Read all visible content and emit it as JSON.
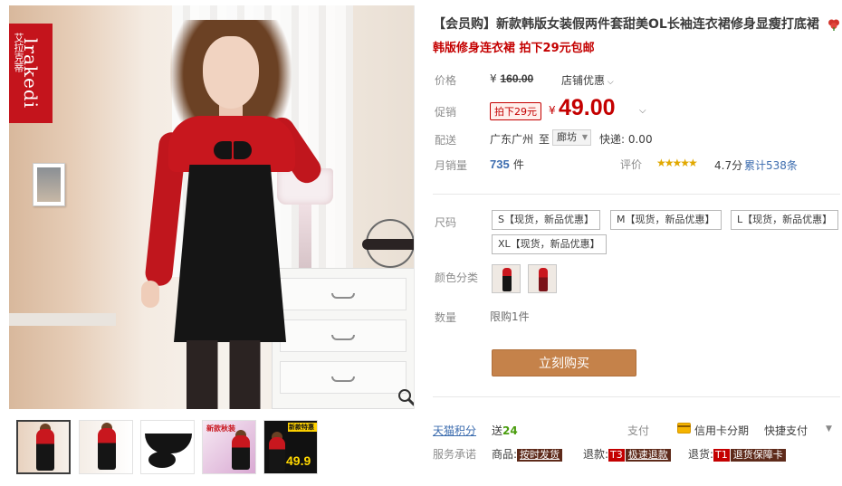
{
  "gallery": {
    "brand_logo_latin": "lrakedi",
    "brand_logo_cn": "艾拉克蒂",
    "thumbnails": [
      {
        "label": "",
        "active": true
      },
      {
        "label": "",
        "active": false
      },
      {
        "label": "",
        "active": false
      },
      {
        "label": "新款秋装",
        "active": false
      },
      {
        "label": "新款特惠",
        "price": "49.9",
        "active": false
      }
    ]
  },
  "product": {
    "title": "【会员购】新款韩版女装假两件套甜美OL长袖连衣裙修身显瘦打底裙",
    "subtitle": "韩版修身连衣裙 拍下29元包邮"
  },
  "price": {
    "label": "价格",
    "currency": "¥",
    "original": "160.00",
    "shop_promo": "店铺优惠"
  },
  "promo": {
    "label": "促销",
    "badge": "拍下29元",
    "currency": "¥",
    "price": "49.00"
  },
  "shipping": {
    "label": "配送",
    "from": "广东广州",
    "to_label": "至",
    "to": "廊坊",
    "express": "快递: 0.00"
  },
  "sales": {
    "label": "月销量",
    "count": "735",
    "unit": "件",
    "review_label": "评价",
    "stars": "★★★★★",
    "rating": "4.7分",
    "review_count": "累计538条"
  },
  "options": {
    "size_label": "尺码",
    "sizes": [
      "S【现货，新品优惠】",
      "M【现货，新品优惠】",
      "L【现货，新品优惠】",
      "XL【现货，新品优惠】"
    ],
    "color_label": "颜色分类",
    "quantity_label": "数量",
    "quantity_limit": "限购1件"
  },
  "actions": {
    "buy_now": "立刻购买"
  },
  "footer": {
    "points_label": "天猫积分",
    "points_prefix": "送",
    "points_value": "24",
    "pay_label": "支付",
    "pay_credit": "信用卡分期",
    "pay_express": "快捷支付",
    "service_label": "服务承诺",
    "goods_label": "商品:",
    "goods_tag": "按时发货",
    "refund_label": "退款:",
    "refund_code": "T3",
    "refund_tag": "极速退款",
    "return_label": "退货:",
    "return_code": "T1",
    "return_tag": "退货保障卡"
  },
  "colors": {
    "accent_red": "#c40000",
    "buy_button": "#c5824a",
    "link_blue": "#3d6daf"
  }
}
